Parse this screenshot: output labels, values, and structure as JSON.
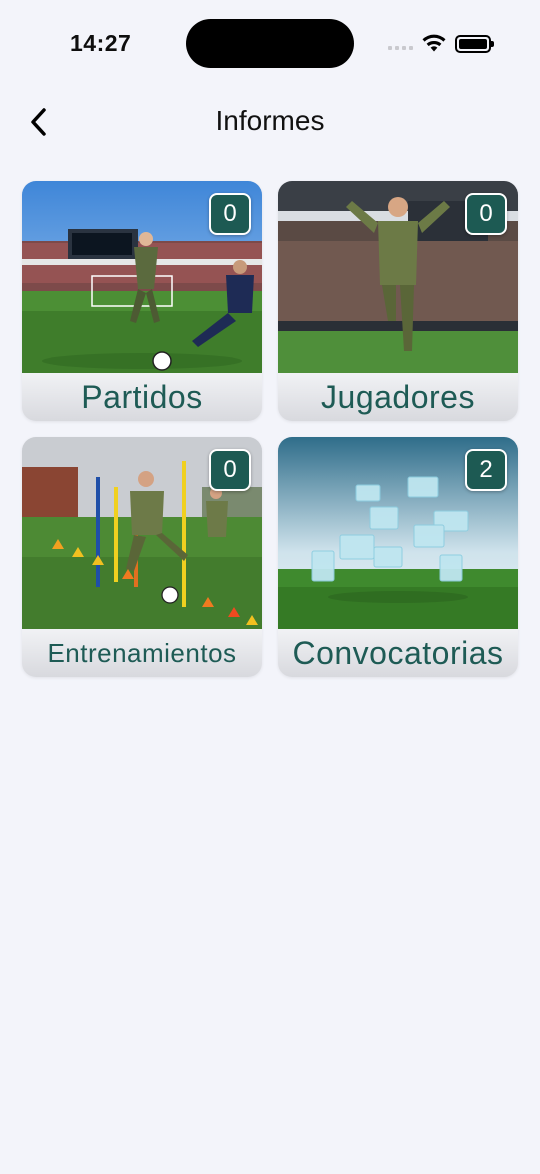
{
  "status": {
    "time": "14:27"
  },
  "header": {
    "title": "Informes"
  },
  "cards": [
    {
      "label": "Partidos",
      "count": "0"
    },
    {
      "label": "Jugadores",
      "count": "0"
    },
    {
      "label": "Entrenamientos",
      "count": "0"
    },
    {
      "label": "Convocatorias",
      "count": "2"
    }
  ],
  "colors": {
    "accent": "#1d5a53",
    "label_text": "#1e5b55",
    "background": "#f3f4fa"
  },
  "icons": [
    "chevron-left-icon",
    "wifi-icon",
    "battery-icon",
    "signal-icon"
  ]
}
